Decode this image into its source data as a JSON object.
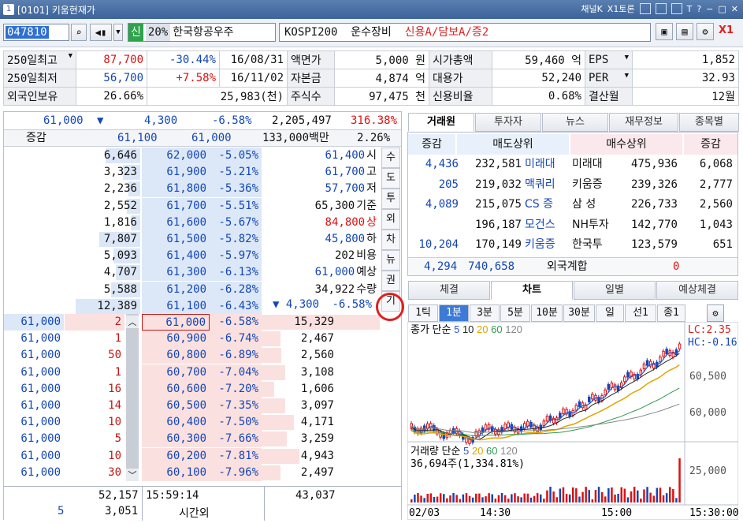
{
  "window": {
    "title": "[0101] 키움현재가",
    "num": "1",
    "channel": "채널K",
    "x1": "X1토론"
  },
  "toolbar": {
    "code": "047810",
    "sin": "신",
    "pct": "20%",
    "name": "한국항공우주",
    "info_a": "KOSPI200  운수장비  ",
    "info_b": "신용A/담보A/증2",
    "x1": "X1"
  },
  "summary": [
    [
      "250일최고",
      "87,700",
      "-30.44%",
      "16/08/31",
      "액면가",
      "5,000 원",
      "시가총액",
      "59,460 억",
      "EPS",
      "1,852"
    ],
    [
      "250일최저",
      "56,700",
      "+7.58%",
      "16/11/02",
      "자본금",
      "4,874 억",
      "대용가",
      "52,240",
      "PER",
      "32.93"
    ],
    [
      "외국인보유",
      "26.66%",
      "25,983(천)",
      "",
      "주식수",
      "97,475 천",
      "신용비율",
      "0.68%",
      "결산월",
      "12월"
    ]
  ],
  "quote": {
    "price": "61,000",
    "arrow": "▼",
    "change": "4,300",
    "rate": "-6.58%",
    "volume": "2,205,497",
    "turnover": "316.38%"
  },
  "ob_header": {
    "label": "증감",
    "ask_sum": "61,100",
    "bid_sum": "61,000",
    "amount": "133,000백만",
    "pct": "2.26%"
  },
  "asks": [
    [
      "6,646",
      "62,000",
      "-5.05%"
    ],
    [
      "3,323",
      "61,900",
      "-5.21%"
    ],
    [
      "2,236",
      "61,800",
      "-5.36%"
    ],
    [
      "2,552",
      "61,700",
      "-5.51%"
    ],
    [
      "1,816",
      "61,600",
      "-5.67%"
    ],
    [
      "7,807",
      "61,500",
      "-5.82%"
    ],
    [
      "5,093",
      "61,400",
      "-5.97%"
    ],
    [
      "4,707",
      "61,300",
      "-6.13%"
    ],
    [
      "5,588",
      "61,200",
      "-6.28%"
    ],
    [
      "12,389",
      "61,100",
      "-6.43%"
    ]
  ],
  "bids": [
    [
      "61,000",
      "2",
      "61,000",
      "-6.58%",
      "15,329"
    ],
    [
      "61,000",
      "1",
      "60,900",
      "-6.74%",
      "2,467"
    ],
    [
      "61,000",
      "50",
      "60,800",
      "-6.89%",
      "2,560"
    ],
    [
      "61,000",
      "1",
      "60,700",
      "-7.04%",
      "3,108"
    ],
    [
      "61,000",
      "16",
      "60,600",
      "-7.20%",
      "1,606"
    ],
    [
      "61,000",
      "14",
      "60,500",
      "-7.35%",
      "3,097"
    ],
    [
      "61,000",
      "10",
      "60,400",
      "-7.50%",
      "4,171"
    ],
    [
      "61,000",
      "5",
      "60,300",
      "-7.66%",
      "3,259"
    ],
    [
      "61,000",
      "10",
      "60,200",
      "-7.81%",
      "4,943"
    ],
    [
      "61,000",
      "30",
      "60,100",
      "-7.96%",
      "2,497"
    ]
  ],
  "side_info": [
    [
      "61,400",
      "시"
    ],
    [
      "61,700",
      "고"
    ],
    [
      "57,700",
      "저"
    ],
    [
      "65,300",
      "기준"
    ],
    [
      "84,800",
      "상"
    ],
    [
      "45,800",
      "하"
    ],
    [
      "202",
      "비용"
    ],
    [
      "61,000",
      "예상"
    ],
    [
      "34,922",
      "수량"
    ]
  ],
  "side_change": {
    "arrow": "▼",
    "value": "4,300",
    "rate": "-6.58%"
  },
  "vtabs": [
    "수",
    "도",
    "투",
    "외",
    "차",
    "뉴",
    "권",
    "기"
  ],
  "ob_footer": {
    "ask_total": "52,157",
    "time": "15:59:14",
    "bid_total": "43,037",
    "left_count": "5",
    "after_qty": "3,051",
    "after_label": "시간외"
  },
  "broker_tabs": [
    "거래원",
    "투자자",
    "뉴스",
    "재무정보",
    "종목별"
  ],
  "broker_head": [
    "증감",
    "매도상위",
    "매수상위",
    "증감"
  ],
  "brokers": [
    [
      "4,436",
      "232,581",
      "미래대",
      "미래대",
      "475,936",
      "6,068"
    ],
    [
      "205",
      "219,032",
      "맥쿼리",
      "키움증",
      "239,326",
      "2,777"
    ],
    [
      "4,089",
      "215,075",
      "CS 증",
      "삼 성",
      "226,733",
      "2,560"
    ],
    [
      "",
      "196,187",
      "모건스",
      "NH투자",
      "142,770",
      "1,043"
    ],
    [
      "10,204",
      "170,149",
      "키움증",
      "한국투",
      "123,579",
      "651"
    ]
  ],
  "broker_foot": {
    "chg": "4,294",
    "sell": "740,658",
    "label": "외국계합",
    "buy": "0"
  },
  "chart_tabs": [
    "체결",
    "차트",
    "일별",
    "예상체결"
  ],
  "period_tabs": [
    "1틱",
    "1분",
    "3분",
    "5분",
    "10분",
    "30분",
    "일",
    "선1",
    "종1"
  ],
  "chart": {
    "legend_price": "종가 단순",
    "ma": [
      "5",
      "10",
      "20",
      "60",
      "120"
    ],
    "lc": "LC:2.35",
    "hc": "HC:-0.16",
    "ytick1": "60,500",
    "ytick2": "60,000",
    "vol_legend": "거래량 단순",
    "vol_ma": [
      "5",
      "20",
      "60",
      "120"
    ],
    "vol_text": "36,694주(1,334.81%)",
    "vol_tick": "25,000",
    "x_labels": [
      "02/03",
      "14:30",
      "15:00",
      "15:30:00"
    ]
  },
  "colors": {
    "ma5": "#2b57c8",
    "ma10": "#222",
    "ma20": "#e0a400",
    "ma60": "#2f9a52",
    "ma120": "#888"
  }
}
